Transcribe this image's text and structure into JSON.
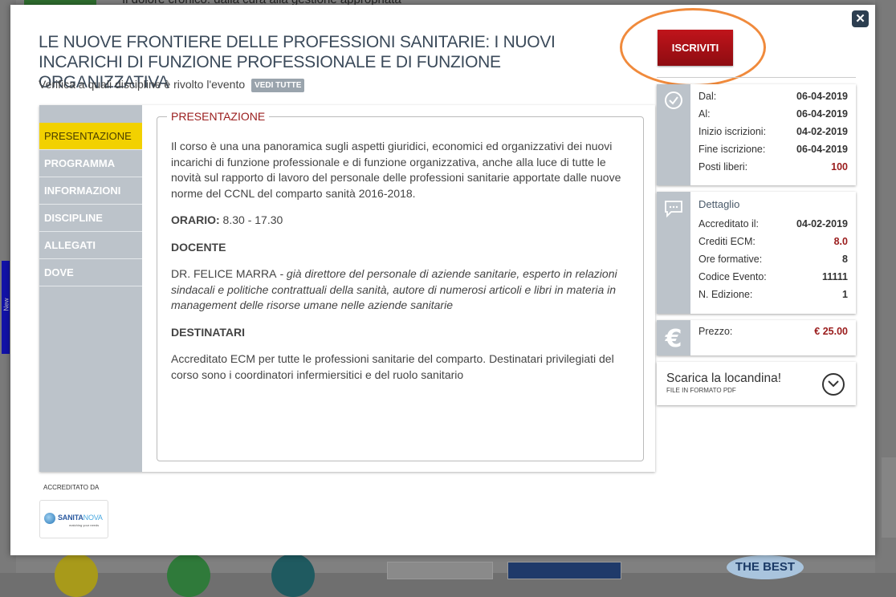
{
  "background": {
    "top_text": "Il dolore cronico: dalla cura alla gestione appropriata",
    "side_tab_text": "New",
    "badge_text": "THE BEST"
  },
  "modal": {
    "close_label": "✕",
    "title": "LE NUOVE FRONTIERE DELLE PROFESSIONI SANITARIE: I NUOVI INCARICHI DI FUNZIONE PROFESSIONALE E DI FUNZIONE ORGANIZZATIVA",
    "verify_text": "Verifica a quali discipline è rivolto l'evento",
    "vedi_tutte": "VEDI TUTTE",
    "iscriviti": "ISCRIVITI"
  },
  "nav": {
    "items": [
      "PRESENTAZIONE",
      "PROGRAMMA",
      "INFORMAZIONI",
      "DISCIPLINE",
      "ALLEGATI",
      "DOVE"
    ],
    "active": "PRESENTAZIONE"
  },
  "presentazione": {
    "legend": "PRESENTAZIONE",
    "intro": "Il corso è una una panoramica sugli aspetti giuridici, economici ed organizzativi dei nuovi incarichi di funzione professionale e di funzione organizzativa, anche alla luce di tutte le novità sul rapporto di lavoro del personale delle professioni sanitarie apportate dalle nuove norme del CCNL del comparto sanità 2016-2018.",
    "orario_label": "ORARIO:",
    "orario_value": " 8.30 - 17.30",
    "docente_heading": "DOCENTE",
    "docente_name": "DR. FELICE MARRA",
    "docente_desc": " - già direttore del personale di aziende sanitarie, esperto in relazioni sindacali e politiche contrattuali della sanità, autore di numerosi articoli e libri in materia in management delle risorse umane nelle aziende sanitarie",
    "destinatari_heading": "DESTINATARI",
    "destinatari_text": "Accreditato ECM per tutte le professioni sanitarie del comparto. Destinatari privilegiati del corso sono i coordinatori infermiersitici e del ruolo sanitario"
  },
  "accreditation": {
    "label": "ACCREDITATO DA",
    "logo_main": "SANITA",
    "logo_accent": "NOVA",
    "logo_sub": "matching your needs"
  },
  "dates_card": {
    "rows": [
      {
        "label": "Dal:",
        "value": "06-04-2019"
      },
      {
        "label": "Al:",
        "value": "06-04-2019"
      },
      {
        "label": "Inizio iscrizioni:",
        "value": "04-02-2019"
      },
      {
        "label": "Fine iscrizione:",
        "value": "06-04-2019"
      },
      {
        "label": "Posti liberi:",
        "value": "100"
      }
    ]
  },
  "detail_card": {
    "heading": "Dettaglio",
    "rows": [
      {
        "label": "Accreditato il:",
        "value": "04-02-2019"
      },
      {
        "label": "Crediti ECM:",
        "value": "8.0"
      },
      {
        "label": "Ore formative:",
        "value": "8"
      },
      {
        "label": "Codice Evento:",
        "value": "11111"
      },
      {
        "label": "N. Edizione:",
        "value": "1"
      }
    ]
  },
  "price_card": {
    "label": "Prezzo:",
    "value": "€ 25.00"
  },
  "download": {
    "title": "Scarica la locandina!",
    "subtitle": "FILE IN FORMATO PDF"
  },
  "icons": {
    "clock": "clock-icon",
    "comment": "comment-icon",
    "euro": "euro-icon",
    "download": "chevron-down-circle-icon",
    "close": "close-icon"
  },
  "colors": {
    "accent_red": "#9a1c1c",
    "button_red": "#c0141b",
    "nav_active": "#f2d100",
    "nav_bg": "#bcc3ca",
    "highlight_orange": "#f08a3c"
  }
}
